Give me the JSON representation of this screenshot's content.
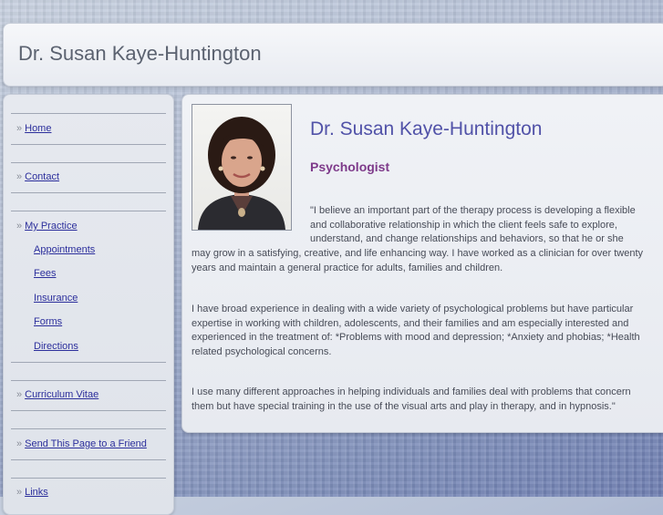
{
  "site": {
    "title": "Dr. Susan Kaye-Huntington"
  },
  "nav": {
    "home": "Home",
    "contact": "Contact",
    "my_practice": "My Practice",
    "appointments": "Appointments",
    "fees": "Fees",
    "insurance": "Insurance",
    "forms": "Forms",
    "directions": "Directions",
    "curriculum_vitae": "Curriculum Vitae",
    "send_page": "Send This Page to a Friend",
    "links": "Links",
    "bullet": "»"
  },
  "main": {
    "heading": "Dr. Susan Kaye-Huntington",
    "subheading": "Psychologist",
    "p1_line1": "\"I believe an important part of the therapy process is developing a flexible",
    "p1_line2": "and collaborative relationship in which the client feels safe to explore,",
    "p1_line3": "understand, and change relationships and behaviors, so that he or she",
    "p1_rest": "may grow in a satisfying, creative, and life enhancing way. I have worked as a clinician for over twenty years and maintain a general practice for adults, families and children.",
    "p2": "I have broad experience in dealing with a wide variety of psychological problems but have particular expertise in working with children, adolescents, and their families and am especially interested and experienced in the treatment of: *Problems with mood and depression; *Anxiety and phobias; *Health related psychological concerns.",
    "p3": "I use many different approaches in helping individuals and families deal with problems that concern them but have special training in the use of the visual arts and play in therapy, and in hypnosis.\""
  },
  "colors": {
    "link": "#2c2f9c",
    "heading": "#5152a8",
    "subheading": "#7e3a8a",
    "body_text": "#474b57"
  }
}
